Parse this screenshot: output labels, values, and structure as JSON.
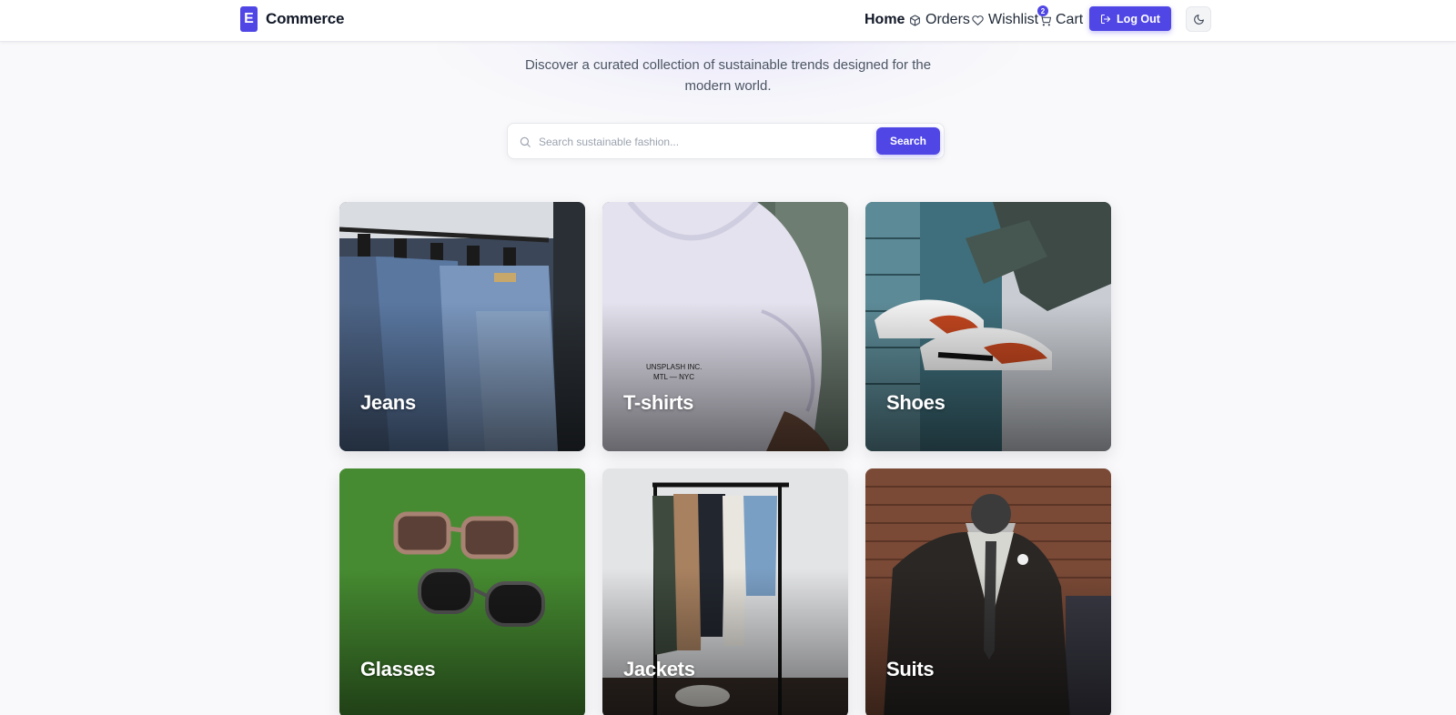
{
  "brand": {
    "mark": "E",
    "name": "Commerce"
  },
  "nav": {
    "home": "Home",
    "orders": "Orders",
    "wishlist": "Wishlist",
    "cart": "Cart",
    "cart_count": "2",
    "logout": "Log Out"
  },
  "hero": {
    "subtitle": "Discover a curated collection of sustainable trends designed for the modern world."
  },
  "search": {
    "placeholder": "Search sustainable fashion...",
    "value": "",
    "button": "Search"
  },
  "categories": [
    {
      "label": "Jeans"
    },
    {
      "label": "T-shirts"
    },
    {
      "label": "Shoes"
    },
    {
      "label": "Glasses"
    },
    {
      "label": "Jackets"
    },
    {
      "label": "Suits"
    }
  ],
  "colors": {
    "accent": "#4f46e5",
    "background": "#f9f9fb"
  }
}
